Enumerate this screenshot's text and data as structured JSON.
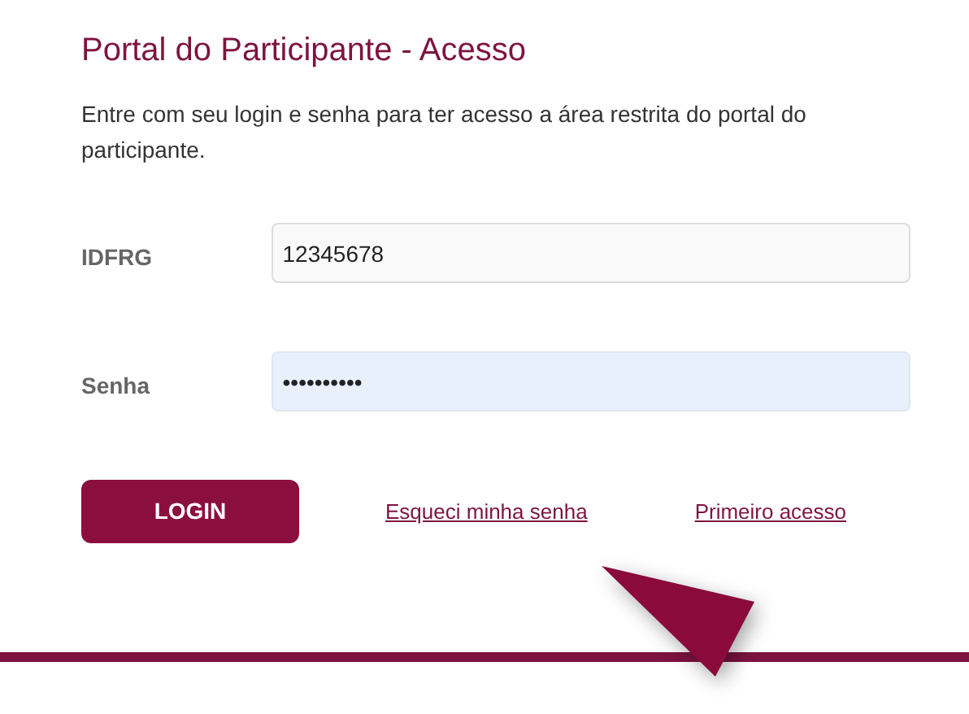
{
  "title": "Portal do Participante - Acesso",
  "intro": "Entre com seu login e senha para ter acesso a área restrita do portal do participante.",
  "fields": [
    {
      "label": "IDFRG",
      "value": "12345678",
      "autofilled": false
    },
    {
      "label": "Senha",
      "value": "••••••••••",
      "autofilled": true
    }
  ],
  "login_button": "LOGIN",
  "links": [
    "Esqueci minha senha",
    "Primeiro acesso"
  ]
}
